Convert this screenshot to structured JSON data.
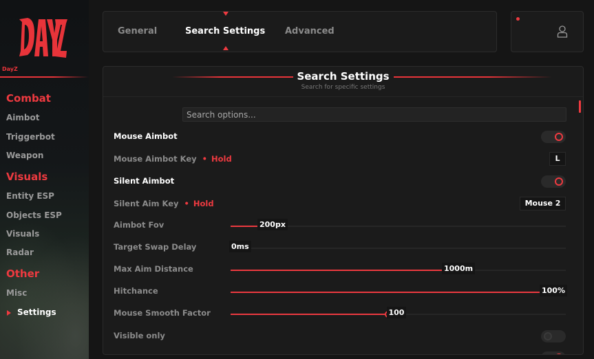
{
  "sidebar": {
    "logo_caption": "DayZ",
    "sections": [
      {
        "title": "Combat",
        "items": [
          "Aimbot",
          "Triggerbot",
          "Weapon"
        ]
      },
      {
        "title": "Visuals",
        "items": [
          "Entity ESP",
          "Objects ESP",
          "Visuals",
          "Radar"
        ]
      },
      {
        "title": "Other",
        "items": [
          "Misc",
          "Settings"
        ]
      }
    ],
    "active_item": "Settings"
  },
  "tabs": [
    "General",
    "Search Settings",
    "Advanced"
  ],
  "active_tab": "Search Settings",
  "panel": {
    "title": "Search Settings",
    "subtitle": "Search for specific settings",
    "search_placeholder": "Search options..."
  },
  "settings": {
    "mouse_aimbot": {
      "label": "Mouse Aimbot",
      "enabled": true
    },
    "mouse_aimbot_key": {
      "label": "Mouse Aimbot Key",
      "mode": "Hold",
      "key": "L"
    },
    "silent_aimbot": {
      "label": "Silent Aimbot",
      "enabled": true
    },
    "silent_aim_key": {
      "label": "Silent Aim Key",
      "mode": "Hold",
      "key": "Mouse 2"
    },
    "aimbot_fov": {
      "label": "Aimbot Fov",
      "value_text": "200px",
      "fraction": 0.1
    },
    "target_swap_delay": {
      "label": "Target Swap Delay",
      "value_text": "0ms",
      "fraction": 0.0
    },
    "max_aim_distance": {
      "label": "Max Aim Distance",
      "value_text": "1000m",
      "fraction": 0.655
    },
    "hitchance": {
      "label": "Hitchance",
      "value_text": "100%",
      "fraction": 1.0
    },
    "mouse_smooth_factor": {
      "label": "Mouse Smooth Factor",
      "value_text": "100",
      "fraction": 0.47
    },
    "visible_only": {
      "label": "Visible only",
      "enabled": false
    }
  },
  "colors": {
    "accent": "#ee3a40",
    "background": "#151515",
    "panel": "#1b1b1b"
  },
  "icons": {
    "user": "user-icon",
    "logo": "dayz-logo"
  }
}
